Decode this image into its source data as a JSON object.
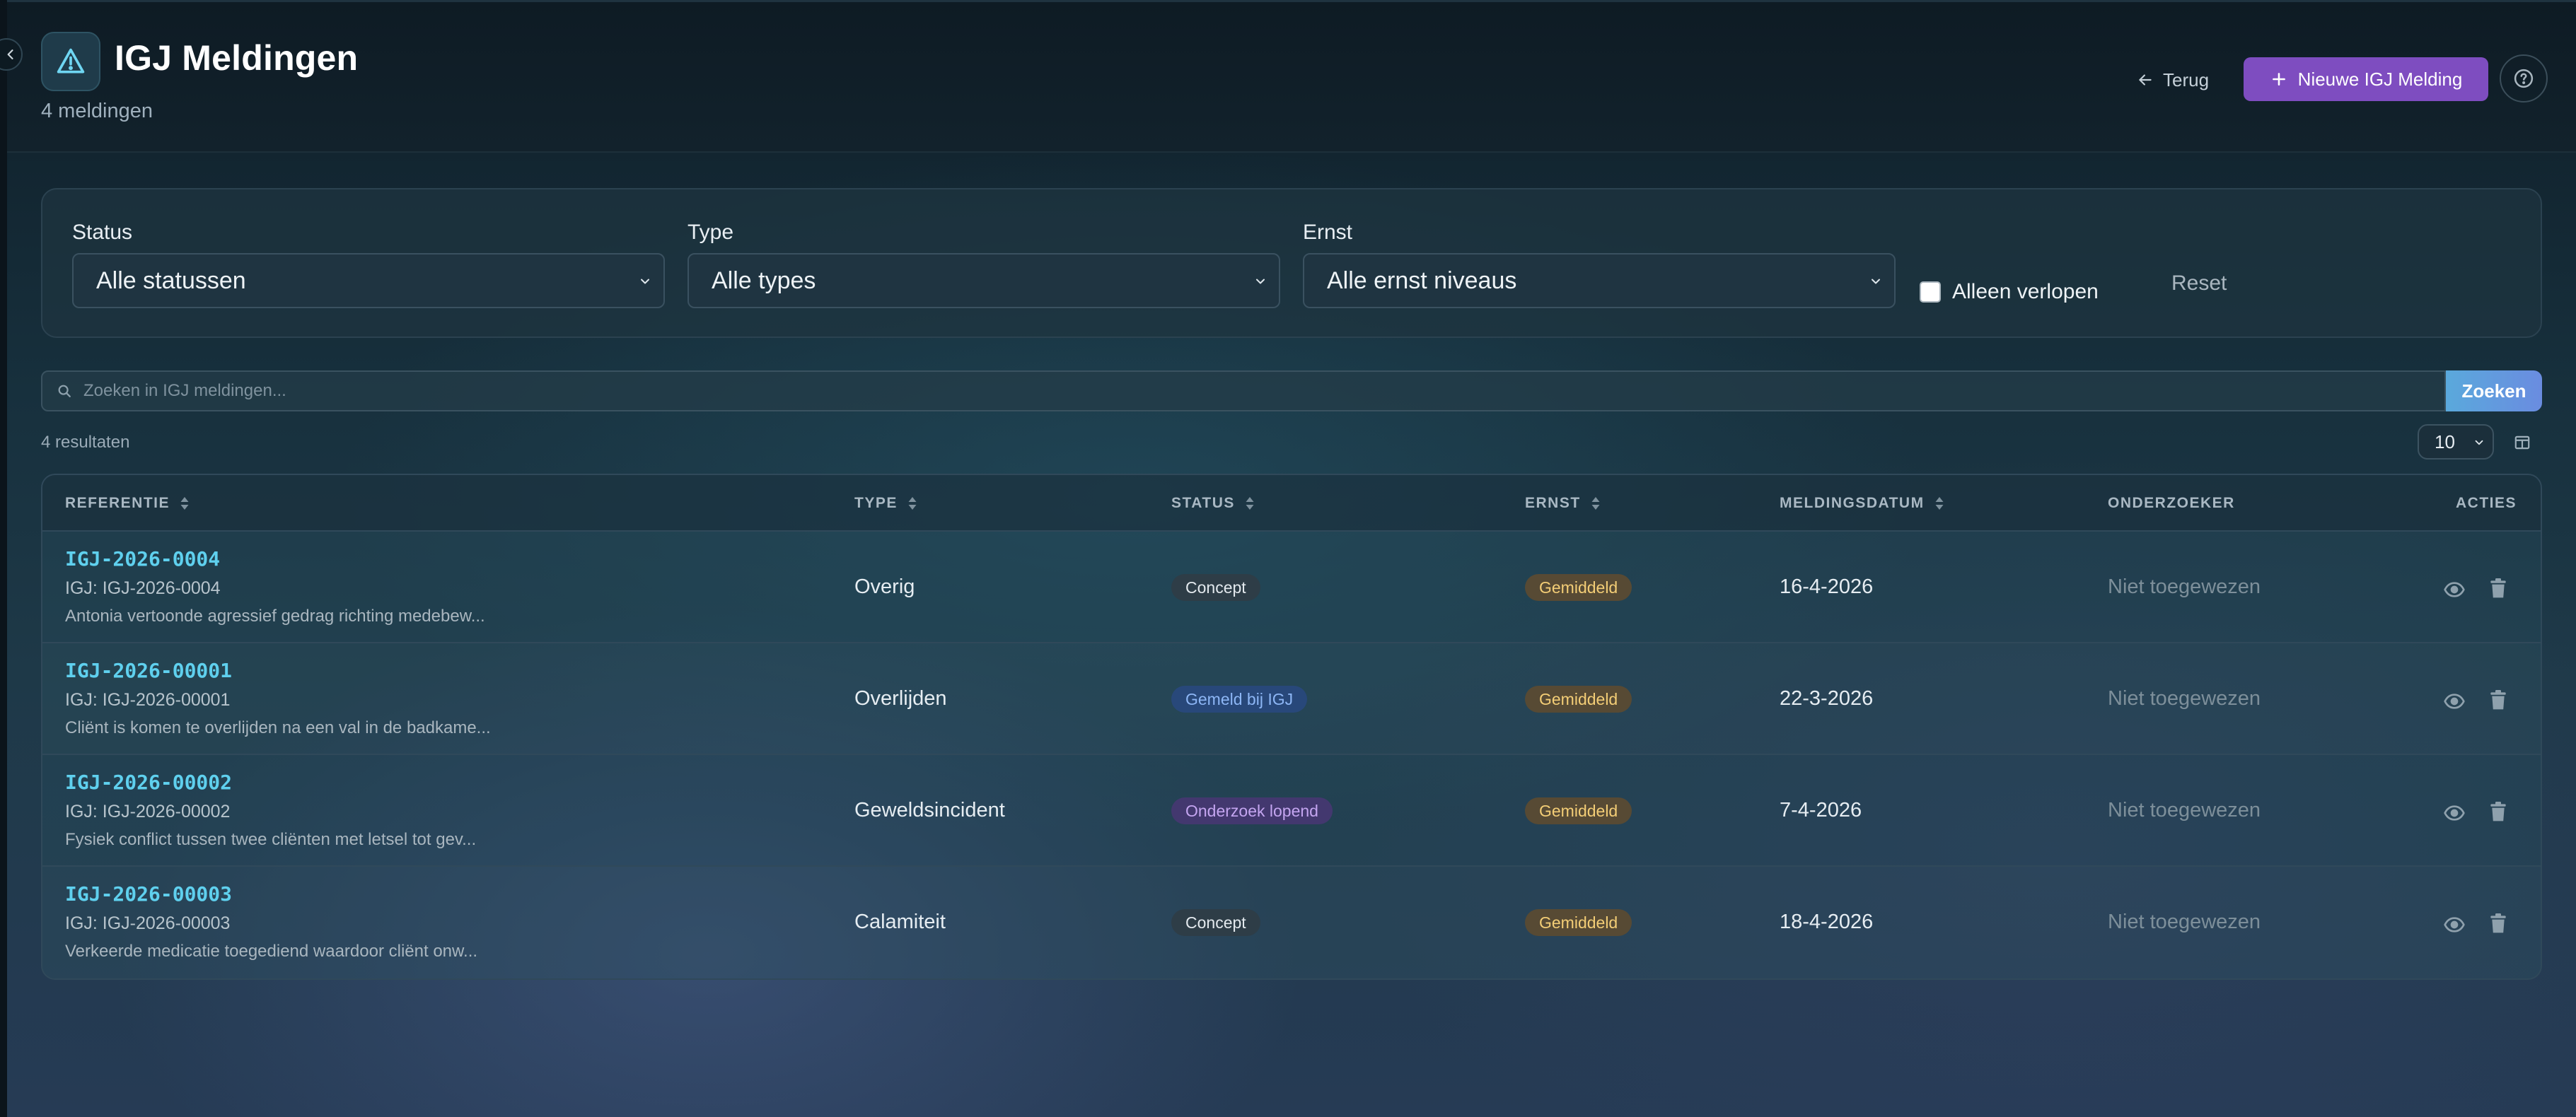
{
  "header": {
    "title": "IGJ Meldingen",
    "subtitle": "4 meldingen",
    "back_label": "Terug",
    "new_label": "Nieuwe IGJ Melding"
  },
  "filters": {
    "status": {
      "label": "Status",
      "value": "Alle statussen"
    },
    "type": {
      "label": "Type",
      "value": "Alle types"
    },
    "severity": {
      "label": "Ernst",
      "value": "Alle ernst niveaus"
    },
    "expired_only_label": "Alleen verlopen",
    "reset_label": "Reset"
  },
  "search": {
    "placeholder": "Zoeken in IGJ meldingen...",
    "button_label": "Zoeken"
  },
  "results": {
    "count_label": "4 resultaten",
    "page_size": "10"
  },
  "table": {
    "columns": {
      "reference": "REFERENTIE",
      "type": "TYPE",
      "status": "STATUS",
      "severity": "ERNST",
      "date": "MELDINGSDATUM",
      "investigator": "ONDERZOEKER",
      "actions": "ACTIES"
    },
    "rows": [
      {
        "reference": "IGJ-2026-0004",
        "igj_ref": "IGJ: IGJ-2026-0004",
        "description": "Antonia vertoonde agressief gedrag richting medebew...",
        "type": "Overig",
        "status": "Concept",
        "severity": "Gemiddeld",
        "date": "16-4-2026",
        "investigator": "Niet toegewezen"
      },
      {
        "reference": "IGJ-2026-00001",
        "igj_ref": "IGJ: IGJ-2026-00001",
        "description": "Cliënt is komen te overlijden na een val in de badkame...",
        "type": "Overlijden",
        "status": "Gemeld bij IGJ",
        "severity": "Gemiddeld",
        "date": "22-3-2026",
        "investigator": "Niet toegewezen"
      },
      {
        "reference": "IGJ-2026-00002",
        "igj_ref": "IGJ: IGJ-2026-00002",
        "description": "Fysiek conflict tussen twee cliënten met letsel tot gev...",
        "type": "Geweldsincident",
        "status": "Onderzoek lopend",
        "severity": "Gemiddeld",
        "date": "7-4-2026",
        "investigator": "Niet toegewezen"
      },
      {
        "reference": "IGJ-2026-00003",
        "igj_ref": "IGJ: IGJ-2026-00003",
        "description": "Verkeerde medicatie toegediend waardoor cliënt onw...",
        "type": "Calamiteit",
        "status": "Concept",
        "severity": "Gemiddeld",
        "date": "18-4-2026",
        "investigator": "Niet toegewezen"
      }
    ]
  },
  "colors": {
    "accent_purple": "#7e4dc0",
    "link_cyan": "#5fd0ee",
    "search_button": "#5aa9dc",
    "badge_amber": "#f3cd76",
    "badge_blue": "#8db6f5",
    "badge_purple": "#c4a5f0"
  },
  "icons": {
    "collapse": "chevron-left-icon",
    "logo": "triangle-warning-icon",
    "back": "arrow-left-icon",
    "new": "plus-icon",
    "help": "question-circle-icon",
    "search": "search-icon",
    "columns": "columns-icon",
    "sort": "sort-icon",
    "view": "eye-icon",
    "delete": "trash-icon"
  }
}
